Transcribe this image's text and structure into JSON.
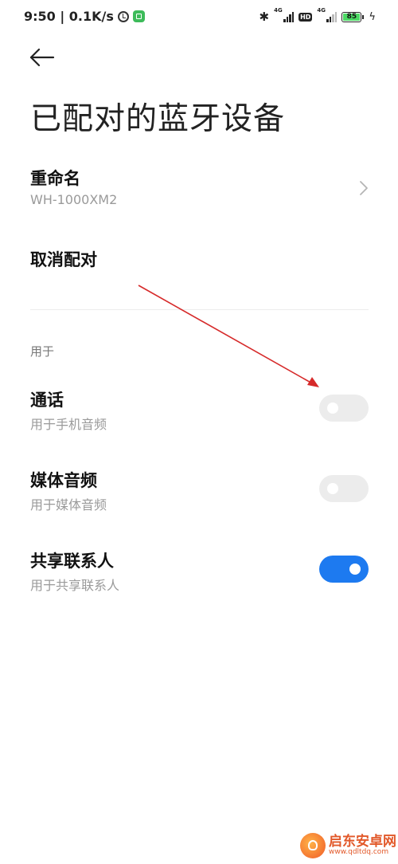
{
  "status_bar": {
    "time_speed": "9:50 | 0.1K/s",
    "signal1_tag": "4G",
    "hd_label": "HD",
    "signal2_tag": "4G",
    "battery_level": "85"
  },
  "header": {
    "title": "已配对的蓝牙设备"
  },
  "rename": {
    "title": "重命名",
    "value": "WH-1000XM2"
  },
  "unpair": {
    "title": "取消配对"
  },
  "section": {
    "header": "用于"
  },
  "options": [
    {
      "title": "通话",
      "subtitle": "用于手机音频",
      "enabled": false
    },
    {
      "title": "媒体音频",
      "subtitle": "用于媒体音频",
      "enabled": false
    },
    {
      "title": "共享联系人",
      "subtitle": "用于共享联系人",
      "enabled": true
    }
  ],
  "watermark": {
    "name": "启东安卓网",
    "url": "www.qdltdq.com"
  },
  "colors": {
    "toggle_on": "#1d7af0",
    "toggle_off": "#ececec",
    "annotation": "#d62a2a",
    "battery": "#4cd964"
  },
  "icons": [
    "alarm-icon",
    "app-icon",
    "bluetooth-icon",
    "signal-icon",
    "battery-icon",
    "charging-icon",
    "back-arrow-icon",
    "chevron-right-icon"
  ]
}
